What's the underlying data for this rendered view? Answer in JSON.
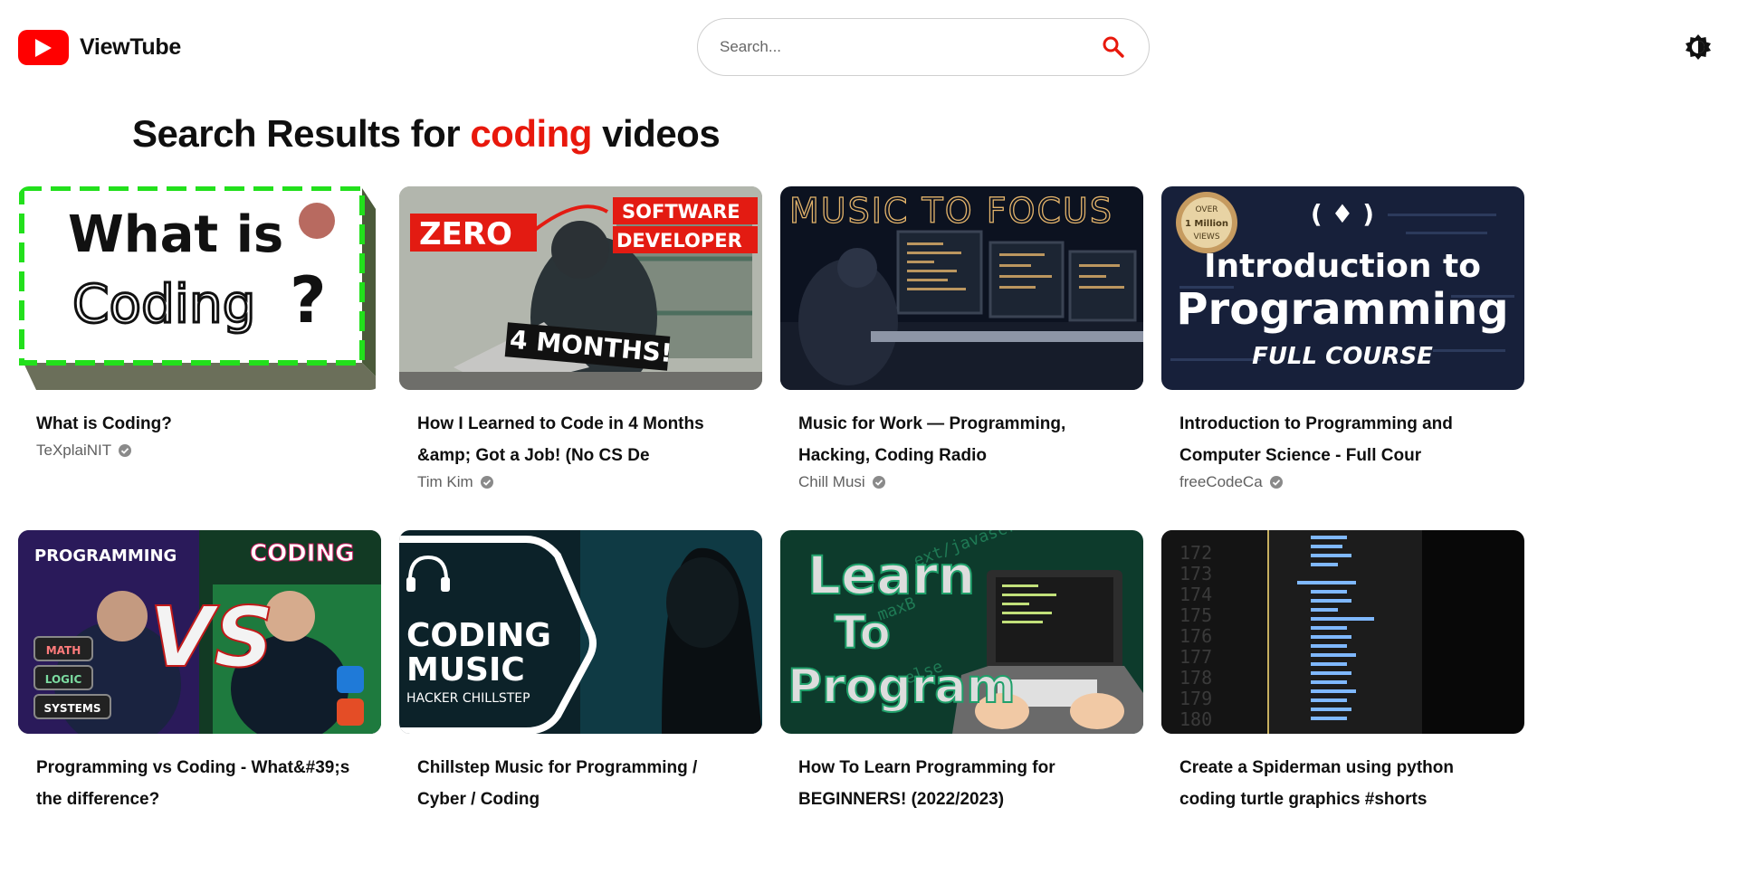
{
  "app": {
    "name": "ViewTube",
    "brand_color": "#ff0000",
    "accent_color": "#e8180c"
  },
  "header": {
    "logo_icon": "play-logo-icon",
    "search_placeholder": "Search...",
    "search_value": "",
    "search_icon": "search-icon",
    "theme_toggle_icon": "brightness-icon"
  },
  "results": {
    "prefix": "Search Results for ",
    "query": "coding",
    "suffix": " videos"
  },
  "videos": [
    {
      "title": "What is Coding?",
      "channel": "TeXplaiNIT",
      "verified": true,
      "thumb_text": [
        "What is",
        "Coding",
        "?"
      ]
    },
    {
      "title": "How I Learned to Code in 4 Months &amp; Got a Job! (No CS De",
      "channel": "Tim Kim",
      "verified": true,
      "thumb_text": [
        "ZERO",
        "SOFTWARE",
        "DEVELOPER",
        "4 MONTHS!"
      ]
    },
    {
      "title": "Music for Work — Programming, Hacking, Coding Radio",
      "channel": "Chill Musi",
      "verified": true,
      "thumb_text": [
        "MUSIC TO FOCUS"
      ]
    },
    {
      "title": "Introduction to Programming and Computer Science - Full Cour",
      "channel": "freeCodeCa",
      "verified": true,
      "thumb_text": [
        "OVER",
        "1 Million",
        "VIEWS",
        "Introduction to",
        "Programming",
        "FULL COURSE"
      ]
    },
    {
      "title": "Programming vs Coding - What&#39;s the difference?",
      "channel": "",
      "verified": false,
      "thumb_text": [
        "PROGRAMMING",
        "CODING",
        "VS",
        "MATH",
        "LOGIC",
        "SYSTEMS"
      ]
    },
    {
      "title": "Chillstep Music for Programming / Cyber / Coding",
      "channel": "",
      "verified": false,
      "thumb_text": [
        "CODING",
        "MUSIC",
        "HACKER CHILLSTEP"
      ]
    },
    {
      "title": "How To Learn Programming for BEGINNERS! (2022/2023)",
      "channel": "",
      "verified": false,
      "thumb_text": [
        "Learn",
        "To",
        "Program"
      ]
    },
    {
      "title": "Create a Spiderman using python coding turtle graphics #shorts",
      "channel": "",
      "verified": false,
      "thumb_text": [
        "172",
        "173",
        "174",
        "175",
        "176",
        "177",
        "178",
        "179",
        "180"
      ]
    }
  ]
}
